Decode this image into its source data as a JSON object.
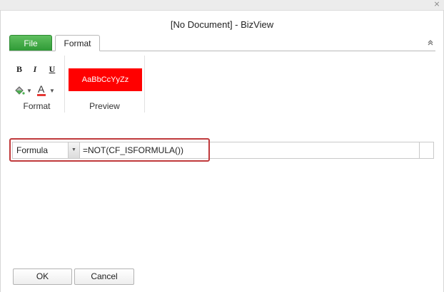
{
  "window": {
    "title": "[No Document] - BizView",
    "close_glyph": "⨯"
  },
  "tabs": [
    {
      "label": "File"
    },
    {
      "label": "Format"
    }
  ],
  "ribbon": {
    "format_group": {
      "label": "Format",
      "bold": "B",
      "italic": "I",
      "underline": "U",
      "font_color_letter": "A"
    },
    "preview_group": {
      "label": "Preview",
      "sample_text": "AaBbCcYyZz",
      "background_color": "#ff0000",
      "text_color": "#ffffff"
    }
  },
  "condition": {
    "type_selected": "Formula",
    "formula_value": "=NOT(CF_ISFORMULA())"
  },
  "buttons": {
    "ok": "OK",
    "cancel": "Cancel"
  },
  "colors": {
    "file_tab": "#3aa640",
    "highlight": "#c0393b"
  }
}
